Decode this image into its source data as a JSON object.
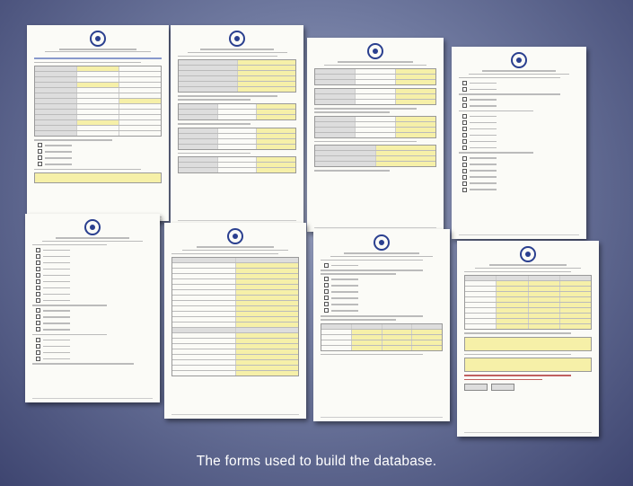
{
  "caption": "The forms used to build the database."
}
